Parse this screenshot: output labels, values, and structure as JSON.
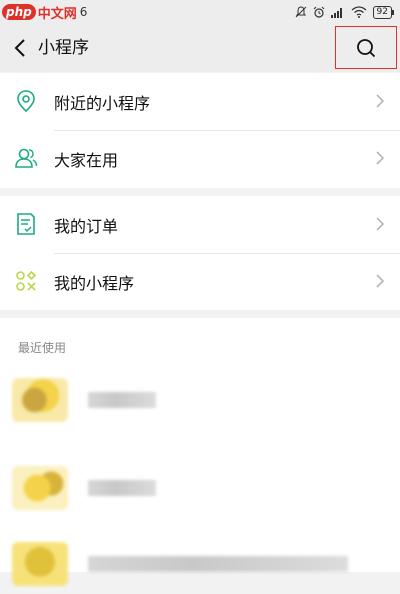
{
  "status_bar": {
    "watermark_badge": "php",
    "watermark_text": "中文网",
    "watermark_tail": "6",
    "battery": "92"
  },
  "nav": {
    "title": "小程序"
  },
  "menu_groups": [
    {
      "items": [
        {
          "label": "附近的小程序",
          "icon": "location-pin-icon"
        },
        {
          "label": "大家在用",
          "icon": "users-icon"
        }
      ]
    },
    {
      "items": [
        {
          "label": "我的订单",
          "icon": "order-list-icon"
        },
        {
          "label": "我的小程序",
          "icon": "mini-program-grid-icon"
        }
      ]
    }
  ],
  "recent": {
    "title": "最近使用"
  },
  "colors": {
    "accent": "#1aad7d",
    "highlight_border": "#e0302a",
    "mini_icon": "#b8d948"
  }
}
